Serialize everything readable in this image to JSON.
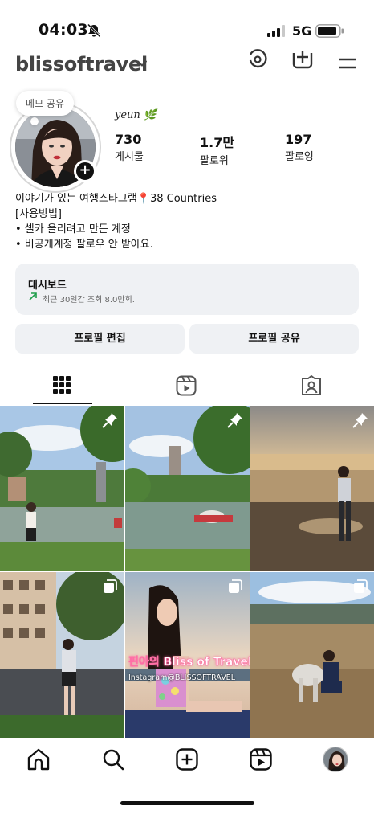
{
  "status_bar": {
    "time": "04:03",
    "network": "5G"
  },
  "header": {
    "username": "blissoftravel"
  },
  "profile": {
    "note_label": "메모 공유",
    "display_name": "yeun 🌿",
    "stats": [
      {
        "value": "730",
        "label": "게시물"
      },
      {
        "value": "1.7만",
        "label": "팔로워"
      },
      {
        "value": "197",
        "label": "팔로잉"
      }
    ],
    "bio": [
      "이야기가 있는 여행스타그램📍38 Countries",
      "[사용방법]",
      "• 셀카 올리려고 만든 계정",
      "• 비공개계정 팔로우 안 받아요."
    ]
  },
  "dashboard": {
    "title": "대시보드",
    "subtitle": "최근 30일간 조회 8.0만회."
  },
  "buttons": {
    "edit_profile": "프로필 편집",
    "share_profile": "프로필 공유"
  },
  "tabs": [
    "grid-icon",
    "reels-icon",
    "tagged-icon"
  ],
  "posts": [
    {
      "type": "pinned",
      "icon": "pin-icon"
    },
    {
      "type": "pinned",
      "icon": "pin-icon"
    },
    {
      "type": "pinned",
      "icon": "pin-icon"
    },
    {
      "type": "carousel",
      "icon": "carousel-icon"
    },
    {
      "type": "carousel",
      "icon": "carousel-icon",
      "overlay_title": "핀아의 Bliss of Travel",
      "overlay_sub": "Instagram@BLISSOFTRAVEL"
    },
    {
      "type": "carousel",
      "icon": "carousel-icon"
    }
  ],
  "bottom_nav": [
    "home-icon",
    "search-icon",
    "create-icon",
    "reels-icon",
    "profile-avatar"
  ]
}
